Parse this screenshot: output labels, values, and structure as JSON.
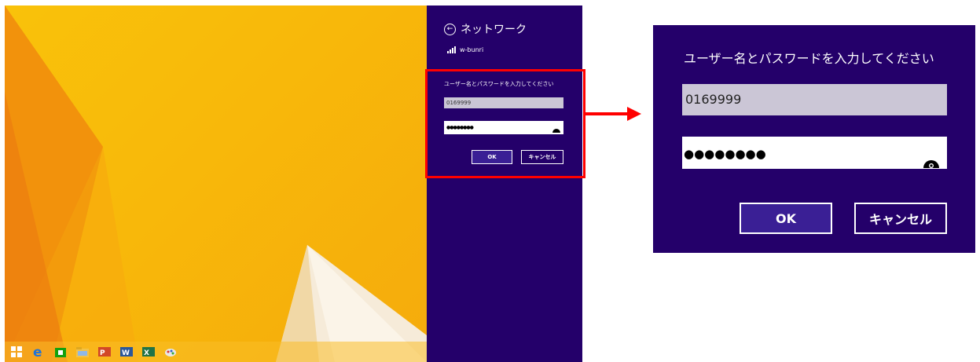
{
  "charm": {
    "title": "ネットワーク",
    "ssid": "w-bunri"
  },
  "dialog": {
    "prompt": "ユーザー名とパスワードを入力してください",
    "username": "0169999",
    "password_masked": "●●●●●●●●",
    "ok_label": "OK",
    "cancel_label": "キャンセル"
  },
  "icons": {
    "back": "back-arrow-icon",
    "wifi": "wifi-signal-icon",
    "reveal": "reveal-password-eye-icon",
    "taskbar": [
      "windows-start-icon",
      "internet-explorer-icon",
      "store-icon",
      "file-explorer-icon",
      "powerpoint-icon",
      "word-icon",
      "excel-icon",
      "paint-icon"
    ]
  },
  "colors": {
    "charm_bg": "#24006a",
    "ok_bg": "#3a1f95",
    "highlight": "#ff0000",
    "desktop": "#f9c20a"
  }
}
